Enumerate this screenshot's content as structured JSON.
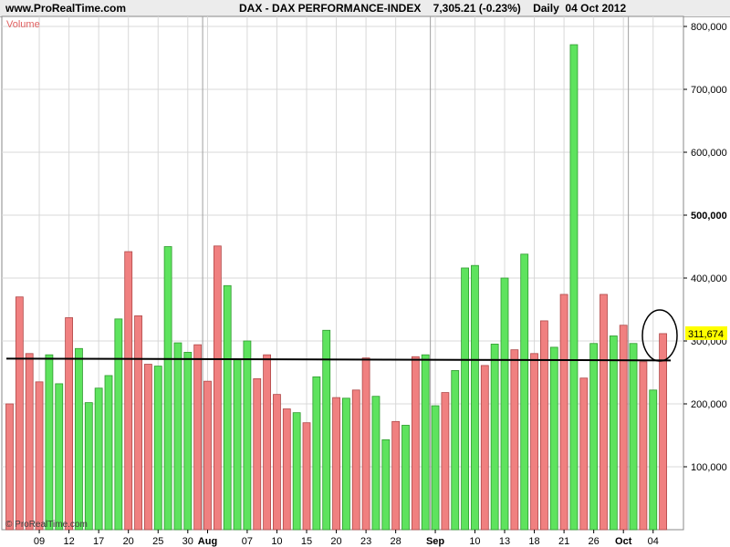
{
  "header": {
    "site": "www.ProRealTime.com",
    "title": "DAX - DAX PERFORMANCE-INDEX    7,305.21 (-0.23%)    Daily  04 Oct 2012"
  },
  "panel": {
    "label": "Volume",
    "copyright": "© ProRealTime.com",
    "last_value": "311,674"
  },
  "colors": {
    "up": "#5ee35e",
    "down": "#f08080",
    "label_bg": "#ffff00",
    "panel_label": "#e06060"
  },
  "chart_data": {
    "type": "bar",
    "title": "DAX - DAX PERFORMANCE-INDEX",
    "ylim": [
      0,
      820000
    ],
    "y_ticks": [
      {
        "value": 100000,
        "label": "100,000",
        "bold": false
      },
      {
        "value": 200000,
        "label": "200,000",
        "bold": false
      },
      {
        "value": 300000,
        "label": "300,000",
        "bold": false
      },
      {
        "value": 400000,
        "label": "400,000",
        "bold": false
      },
      {
        "value": 500000,
        "label": "500,000",
        "bold": true
      },
      {
        "value": 600000,
        "label": "600,000",
        "bold": false
      },
      {
        "value": 700000,
        "label": "700,000",
        "bold": false
      },
      {
        "value": 800000,
        "label": "800,000",
        "bold": false
      }
    ],
    "x_ticks": [
      {
        "index": 3,
        "label": "09",
        "bold": false
      },
      {
        "index": 6,
        "label": "12",
        "bold": false
      },
      {
        "index": 9,
        "label": "17",
        "bold": false
      },
      {
        "index": 12,
        "label": "20",
        "bold": false
      },
      {
        "index": 15,
        "label": "25",
        "bold": false
      },
      {
        "index": 18,
        "label": "30",
        "bold": false
      },
      {
        "index": 20,
        "label": "Aug",
        "bold": true
      },
      {
        "index": 24,
        "label": "07",
        "bold": false
      },
      {
        "index": 27,
        "label": "10",
        "bold": false
      },
      {
        "index": 30,
        "label": "15",
        "bold": false
      },
      {
        "index": 33,
        "label": "20",
        "bold": false
      },
      {
        "index": 36,
        "label": "23",
        "bold": false
      },
      {
        "index": 39,
        "label": "28",
        "bold": false
      },
      {
        "index": 43,
        "label": "Sep",
        "bold": true
      },
      {
        "index": 47,
        "label": "10",
        "bold": false
      },
      {
        "index": 50,
        "label": "13",
        "bold": false
      },
      {
        "index": 53,
        "label": "18",
        "bold": false
      },
      {
        "index": 56,
        "label": "21",
        "bold": false
      },
      {
        "index": 59,
        "label": "26",
        "bold": false
      },
      {
        "index": 62,
        "label": "Oct",
        "bold": true
      },
      {
        "index": 65,
        "label": "04",
        "bold": false
      }
    ],
    "month_dividers": [
      20,
      43,
      63
    ],
    "series": [
      {
        "values": [
          200000,
          370000,
          280000,
          235000,
          278000,
          232000,
          337000,
          288000,
          202000,
          225000,
          245000,
          335000,
          442000,
          340000,
          263000,
          260000,
          450000,
          297000,
          282000,
          294000,
          236000,
          451000,
          388000,
          270000,
          300000,
          240000,
          278000,
          215000,
          192000,
          186000,
          170000,
          243000,
          317000,
          210000,
          209000,
          222000,
          273000,
          212000,
          143000,
          172000,
          166000,
          275000,
          278000,
          197000,
          218000,
          253000,
          416000,
          420000,
          261000,
          295000,
          400000,
          286000,
          438000,
          280000,
          332000,
          290000,
          374000,
          771000,
          241000,
          296000,
          374000,
          308000,
          325000,
          296000,
          267000,
          222000,
          311674
        ],
        "direction": [
          "down",
          "down",
          "down",
          "down",
          "up",
          "up",
          "down",
          "up",
          "up",
          "up",
          "up",
          "up",
          "down",
          "down",
          "down",
          "up",
          "up",
          "up",
          "up",
          "down",
          "down",
          "down",
          "up",
          "up",
          "up",
          "down",
          "down",
          "down",
          "down",
          "up",
          "down",
          "up",
          "up",
          "down",
          "up",
          "down",
          "down",
          "up",
          "up",
          "down",
          "up",
          "down",
          "up",
          "up",
          "down",
          "up",
          "up",
          "up",
          "down",
          "up",
          "up",
          "down",
          "up",
          "down",
          "down",
          "up",
          "down",
          "up",
          "down",
          "up",
          "down",
          "up",
          "down",
          "up",
          "down",
          "up",
          "down"
        ]
      }
    ],
    "horizontal_line": 272000
  }
}
